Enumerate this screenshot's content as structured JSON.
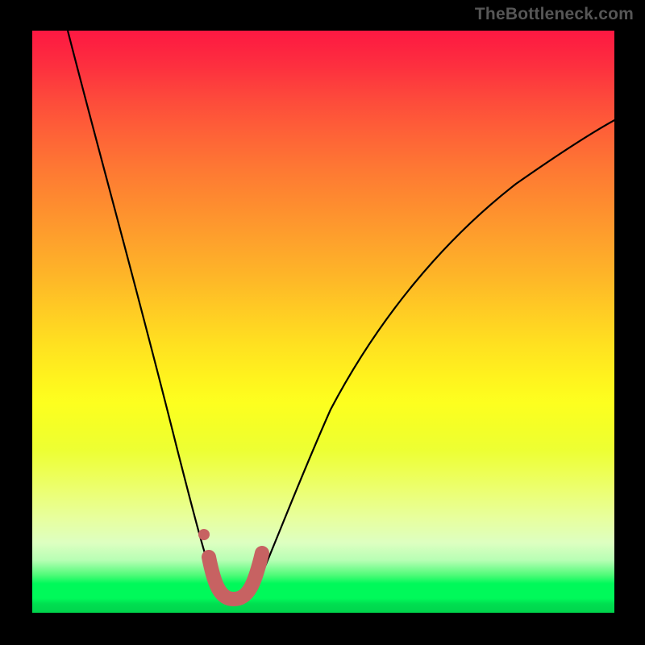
{
  "watermark": "TheBottleneck.com",
  "chart_data": {
    "type": "line",
    "title": "",
    "xlabel": "",
    "ylabel": "",
    "xlim": [
      0,
      1
    ],
    "ylim": [
      0,
      1
    ],
    "series": [
      {
        "name": "bottleneck-curve",
        "description": "V-shaped bottleneck curve with narrow minimum",
        "x": [
          0.06,
          0.1,
          0.14,
          0.18,
          0.22,
          0.26,
          0.3,
          0.315,
          0.33,
          0.345,
          0.36,
          0.375,
          0.39,
          0.41,
          0.44,
          0.48,
          0.54,
          0.6,
          0.68,
          0.76,
          0.84,
          0.92,
          1.0
        ],
        "y": [
          1.0,
          0.88,
          0.76,
          0.63,
          0.5,
          0.35,
          0.18,
          0.09,
          0.04,
          0.02,
          0.02,
          0.04,
          0.09,
          0.18,
          0.3,
          0.4,
          0.5,
          0.57,
          0.64,
          0.7,
          0.75,
          0.8,
          0.85
        ]
      },
      {
        "name": "highlight-segment",
        "description": "Thick salmon highlight marking the minimum region",
        "x": [
          0.3,
          0.315,
          0.33,
          0.345,
          0.36,
          0.375,
          0.39
        ],
        "y": [
          0.1,
          0.05,
          0.03,
          0.02,
          0.03,
          0.05,
          0.1
        ]
      },
      {
        "name": "marker-dot",
        "x": [
          0.295
        ],
        "y": [
          0.135
        ]
      }
    ],
    "colors": {
      "curve": "#000000",
      "highlight": "#c76262",
      "gradient_top": "#fd1842",
      "gradient_mid": "#fff41e",
      "gradient_bottom": "#00d44c"
    }
  }
}
